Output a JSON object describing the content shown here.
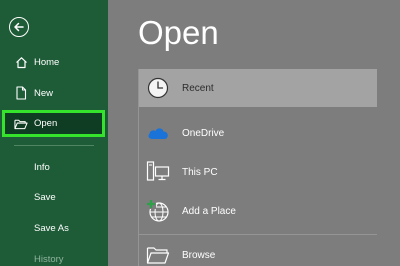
{
  "sidebar": {
    "back_icon": "arrow-left-circle-icon",
    "items": [
      {
        "label": "Home",
        "icon": "home-icon"
      },
      {
        "label": "New",
        "icon": "new-document-icon"
      },
      {
        "label": "Open",
        "icon": "folder-open-icon",
        "selected": true
      },
      {
        "label": "Info"
      },
      {
        "label": "Save"
      },
      {
        "label": "Save As"
      },
      {
        "label": "History"
      }
    ]
  },
  "main": {
    "title": "Open",
    "locations": [
      {
        "label": "Recent",
        "icon": "clock-icon",
        "active": true
      },
      {
        "label": "OneDrive",
        "icon": "cloud-icon"
      },
      {
        "label": "This PC",
        "icon": "computer-icon"
      },
      {
        "label": "Add a Place",
        "icon": "globe-add-icon"
      },
      {
        "label": "Browse",
        "icon": "folder-icon"
      }
    ]
  },
  "colors": {
    "sidebar_bg": "#1e5c38",
    "selected_bg": "#0f3d23",
    "highlight_border": "#35e22c",
    "main_bg": "#7d7d7d",
    "active_location_bg": "#a3a3a3",
    "onedrive_blue": "#1a73d8"
  }
}
